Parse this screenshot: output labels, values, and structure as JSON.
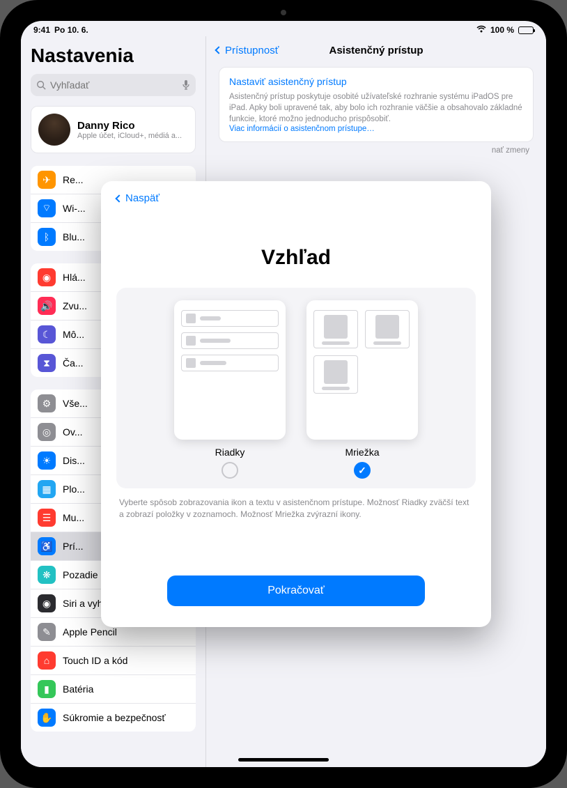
{
  "status": {
    "time": "9:41",
    "date": "Po 10. 6.",
    "battery": "100 %"
  },
  "sidebar": {
    "title": "Nastavenia",
    "search_placeholder": "Vyhľadať",
    "profile": {
      "name": "Danny Rico",
      "sub": "Apple účet, iCloud+, médiá a..."
    },
    "g1": [
      "Re...",
      "Wi-...",
      "Blu..."
    ],
    "g2": [
      "Hlá...",
      "Zvu...",
      "Mô...",
      "Ča..."
    ],
    "g3": [
      "Vše...",
      "Ov...",
      "Dis...",
      "Plo...",
      "Mu...",
      "Prí...",
      "Pozadie",
      "Siri a vyhľadávanie",
      "Apple Pencil",
      "Touch ID a kód",
      "Batéria",
      "Súkromie a bezpečnosť"
    ]
  },
  "content": {
    "back": "Prístupnosť",
    "title": "Asistenčný prístup",
    "card_title": "Nastaviť asistenčný prístup",
    "card_text": "Asistenčný prístup poskytuje osobité užívateľské rozhranie systému iPadOS pre iPad. Apky boli upravené tak, aby bolo ich rozhranie väčšie a obsahovalo základné funkcie, ktoré možno jednoducho prispôsobiť.",
    "card_link": "Viac informácií o asistenčnom prístupe…",
    "trailing": "nať zmeny"
  },
  "sheet": {
    "back": "Naspäť",
    "title": "Vzhľad",
    "opt1": "Riadky",
    "opt2": "Mriežka",
    "desc": "Vyberte spôsob zobrazovania ikon a textu v asistenčnom prístupe. Možnosť Riadky zväčší text a zobrazí položky v zoznamoch. Možnosť Mriežka zvýrazní ikony.",
    "continue": "Pokračovať"
  },
  "icons": {
    "g1": [
      {
        "bg": "#ff9500",
        "glyph": "✈"
      },
      {
        "bg": "#007aff",
        "glyph": "⌔"
      },
      {
        "bg": "#007aff",
        "glyph": "ᛒ"
      }
    ],
    "g2": [
      {
        "bg": "#ff3b30",
        "glyph": "◉"
      },
      {
        "bg": "#ff2d55",
        "glyph": "🔊"
      },
      {
        "bg": "#5856d6",
        "glyph": "☾"
      },
      {
        "bg": "#5856d6",
        "glyph": "⧗"
      }
    ],
    "g3": [
      {
        "bg": "#8e8e93",
        "glyph": "⚙"
      },
      {
        "bg": "#8e8e93",
        "glyph": "◎"
      },
      {
        "bg": "#007aff",
        "glyph": "☀"
      },
      {
        "bg": "#22a6f2",
        "glyph": "▦"
      },
      {
        "bg": "#ff3b30",
        "glyph": "☰"
      },
      {
        "bg": "#007aff",
        "glyph": "♿"
      },
      {
        "bg": "#22c1c3",
        "glyph": "❋"
      },
      {
        "bg": "#2b2b2f",
        "glyph": "◉"
      },
      {
        "bg": "#8e8e93",
        "glyph": "✎"
      },
      {
        "bg": "#ff3b30",
        "glyph": "⌂"
      },
      {
        "bg": "#34c759",
        "glyph": "▮"
      },
      {
        "bg": "#007aff",
        "glyph": "✋"
      }
    ]
  }
}
